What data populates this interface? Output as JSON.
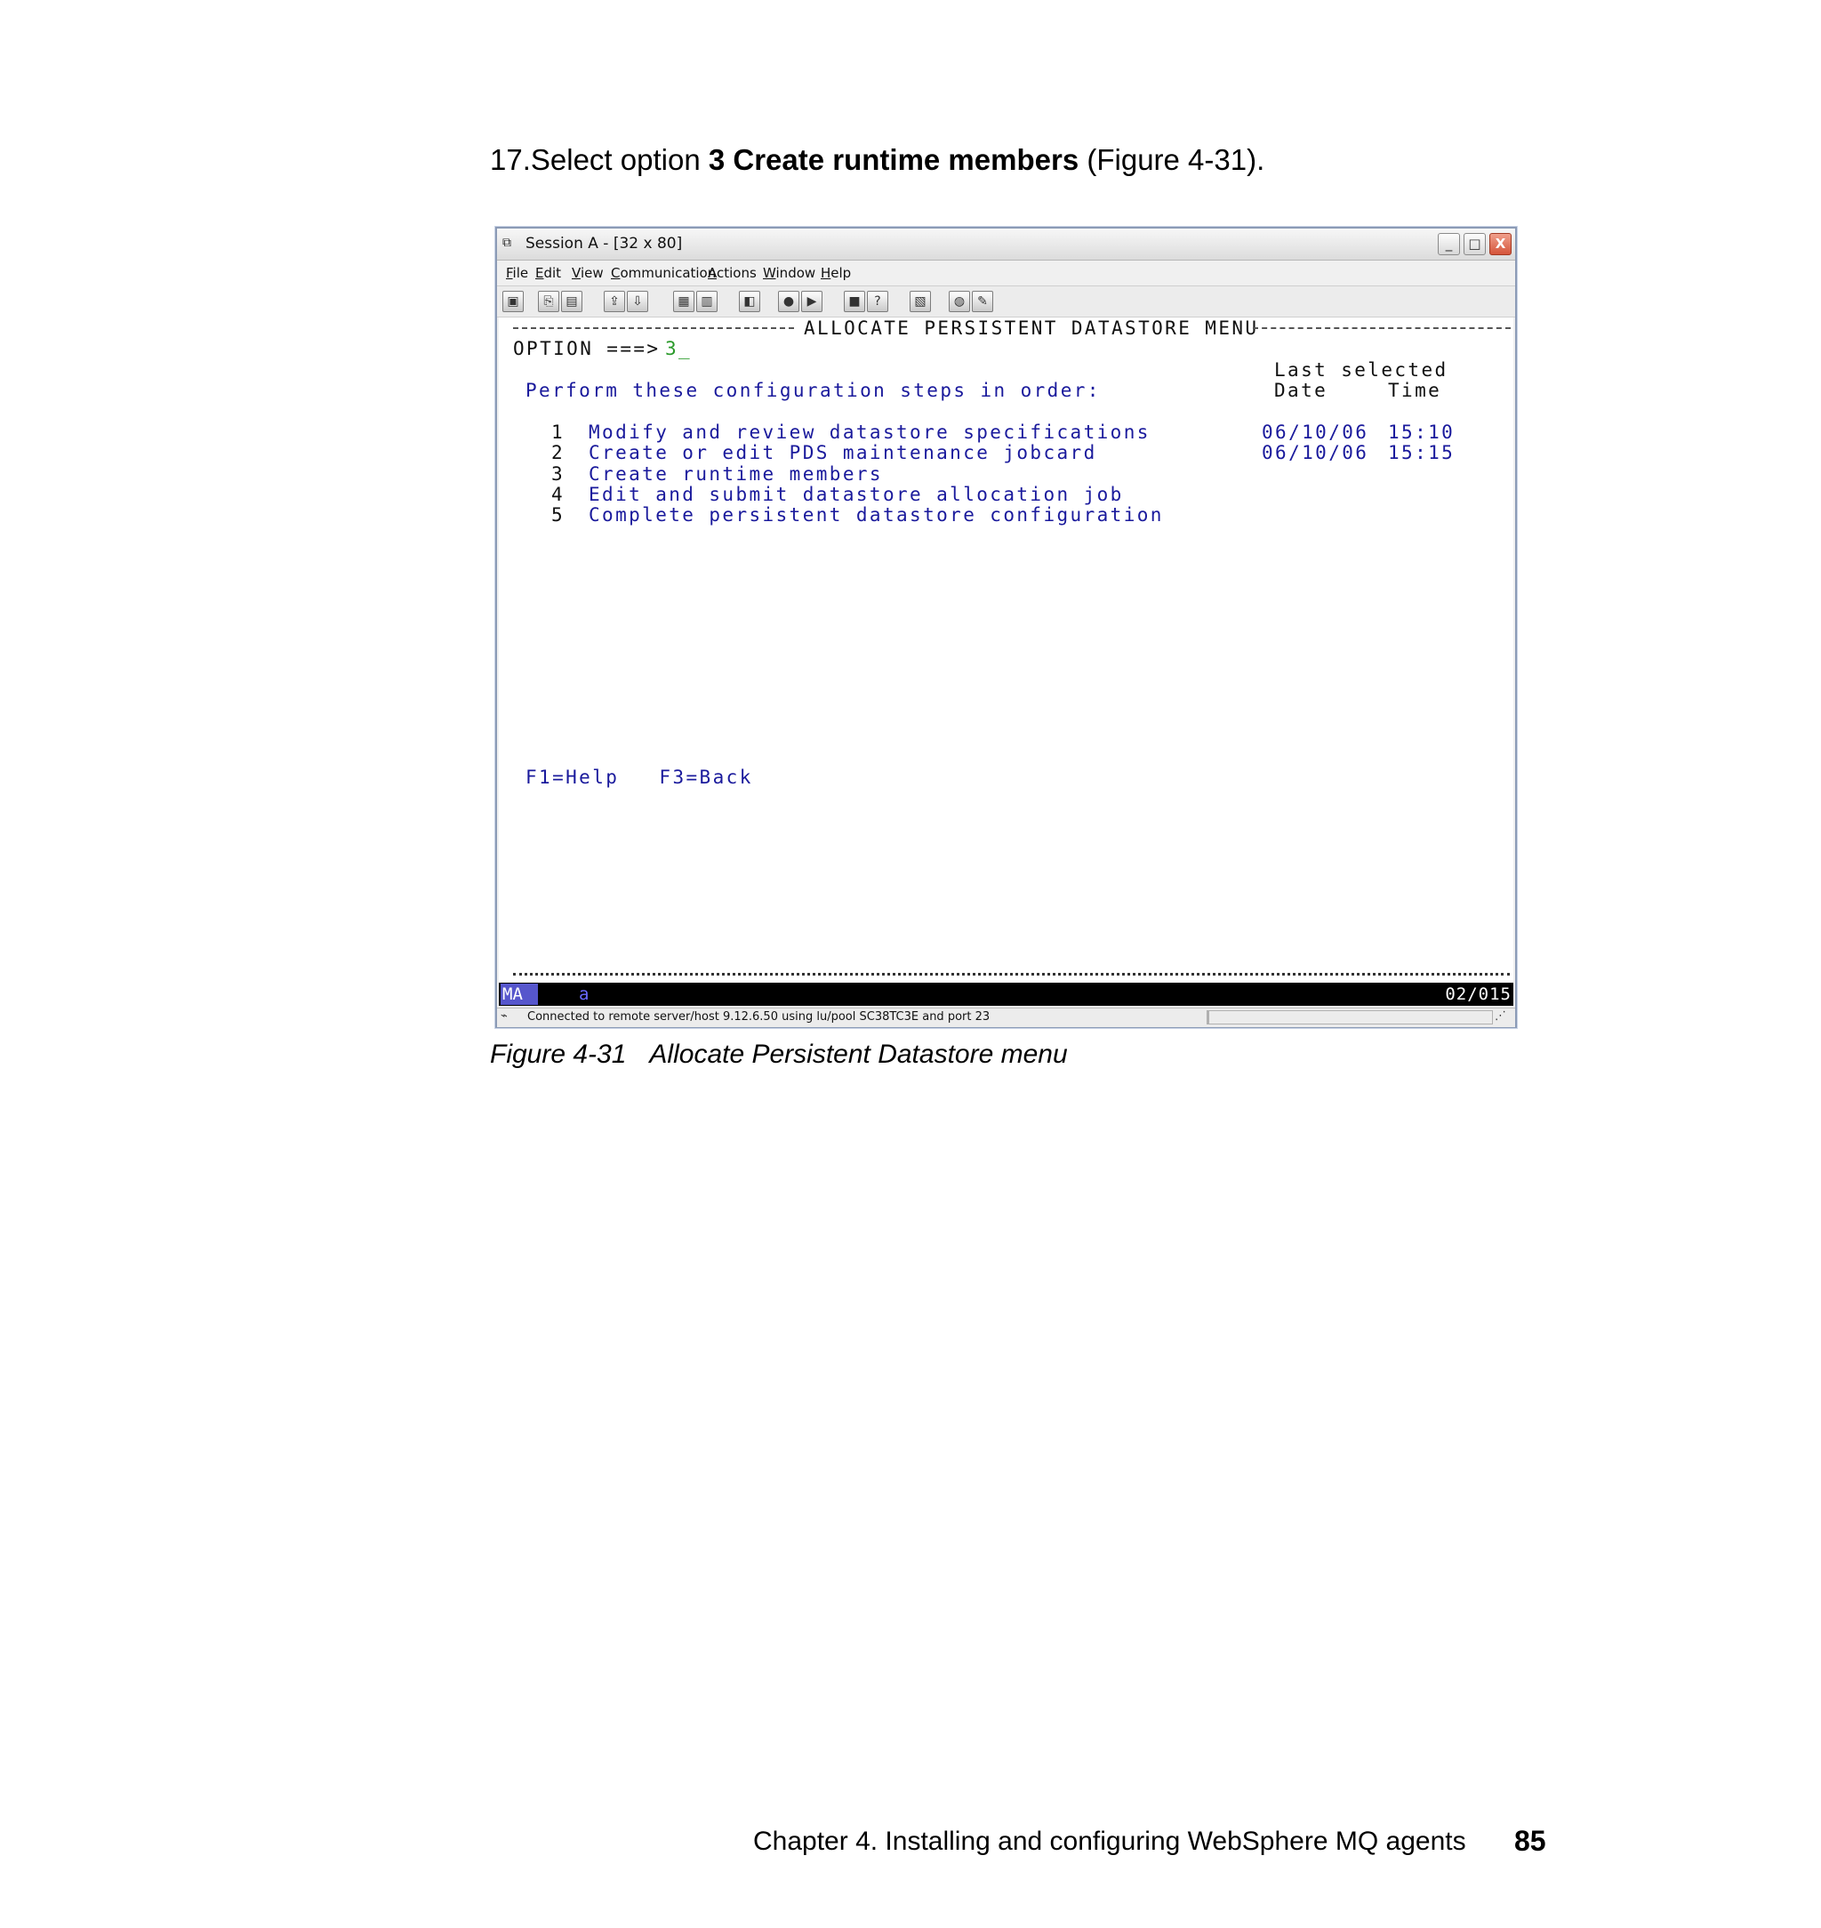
{
  "step": {
    "number": "17.",
    "prefix": "Select option ",
    "bold": "3 Create runtime members",
    "suffix": " (Figure 4-31)."
  },
  "window": {
    "title": "Session A - [32 x 80]",
    "controls": {
      "minimize": "_",
      "maximize": "□",
      "close": "X"
    },
    "menu": [
      "File",
      "Edit",
      "View",
      "Communication",
      "Actions",
      "Window",
      "Help"
    ],
    "toolbar_icons": [
      "print-screen-icon",
      "copy-icon",
      "paste-icon",
      "send-file-icon",
      "receive-file-icon",
      "display-icon",
      "keypad-icon",
      "color-icon",
      "macro-record-icon",
      "macro-play-icon",
      "macro-stop-icon",
      "help-icon",
      "map-icon",
      "globe-icon",
      "edit-icon"
    ]
  },
  "terminal": {
    "heading": "ALLOCATE PERSISTENT DATASTORE MENU",
    "option_prompt": "OPTION ===>",
    "option_value": "3_",
    "instruction": "Perform these configuration steps in order:",
    "last_selected_label": "Last selected",
    "date_header": "Date",
    "time_header": "Time",
    "items": [
      {
        "num": "1",
        "label": "Modify and review datastore specifications",
        "date": "06/10/06",
        "time": "15:10"
      },
      {
        "num": "2",
        "label": "Create or edit PDS maintenance jobcard",
        "date": "06/10/06",
        "time": "15:15"
      },
      {
        "num": "3",
        "label": "Create runtime members",
        "date": "",
        "time": ""
      },
      {
        "num": "4",
        "label": "Edit and submit datastore allocation job",
        "date": "",
        "time": ""
      },
      {
        "num": "5",
        "label": "Complete persistent datastore configuration",
        "date": "",
        "time": ""
      }
    ],
    "function_keys": "F1=Help   F3=Back"
  },
  "oia": {
    "indicator": "MA",
    "mode": "a",
    "cursor_position": "02/015"
  },
  "status_bar": {
    "text": "Connected to remote server/host 9.12.6.50 using lu/pool SC38TC3E and port 23"
  },
  "caption": {
    "label": "Figure 4-31",
    "title": "Allocate Persistent Datastore menu"
  },
  "footer": {
    "chapter": "Chapter 4. Installing and configuring WebSphere MQ agents",
    "page": "85"
  }
}
